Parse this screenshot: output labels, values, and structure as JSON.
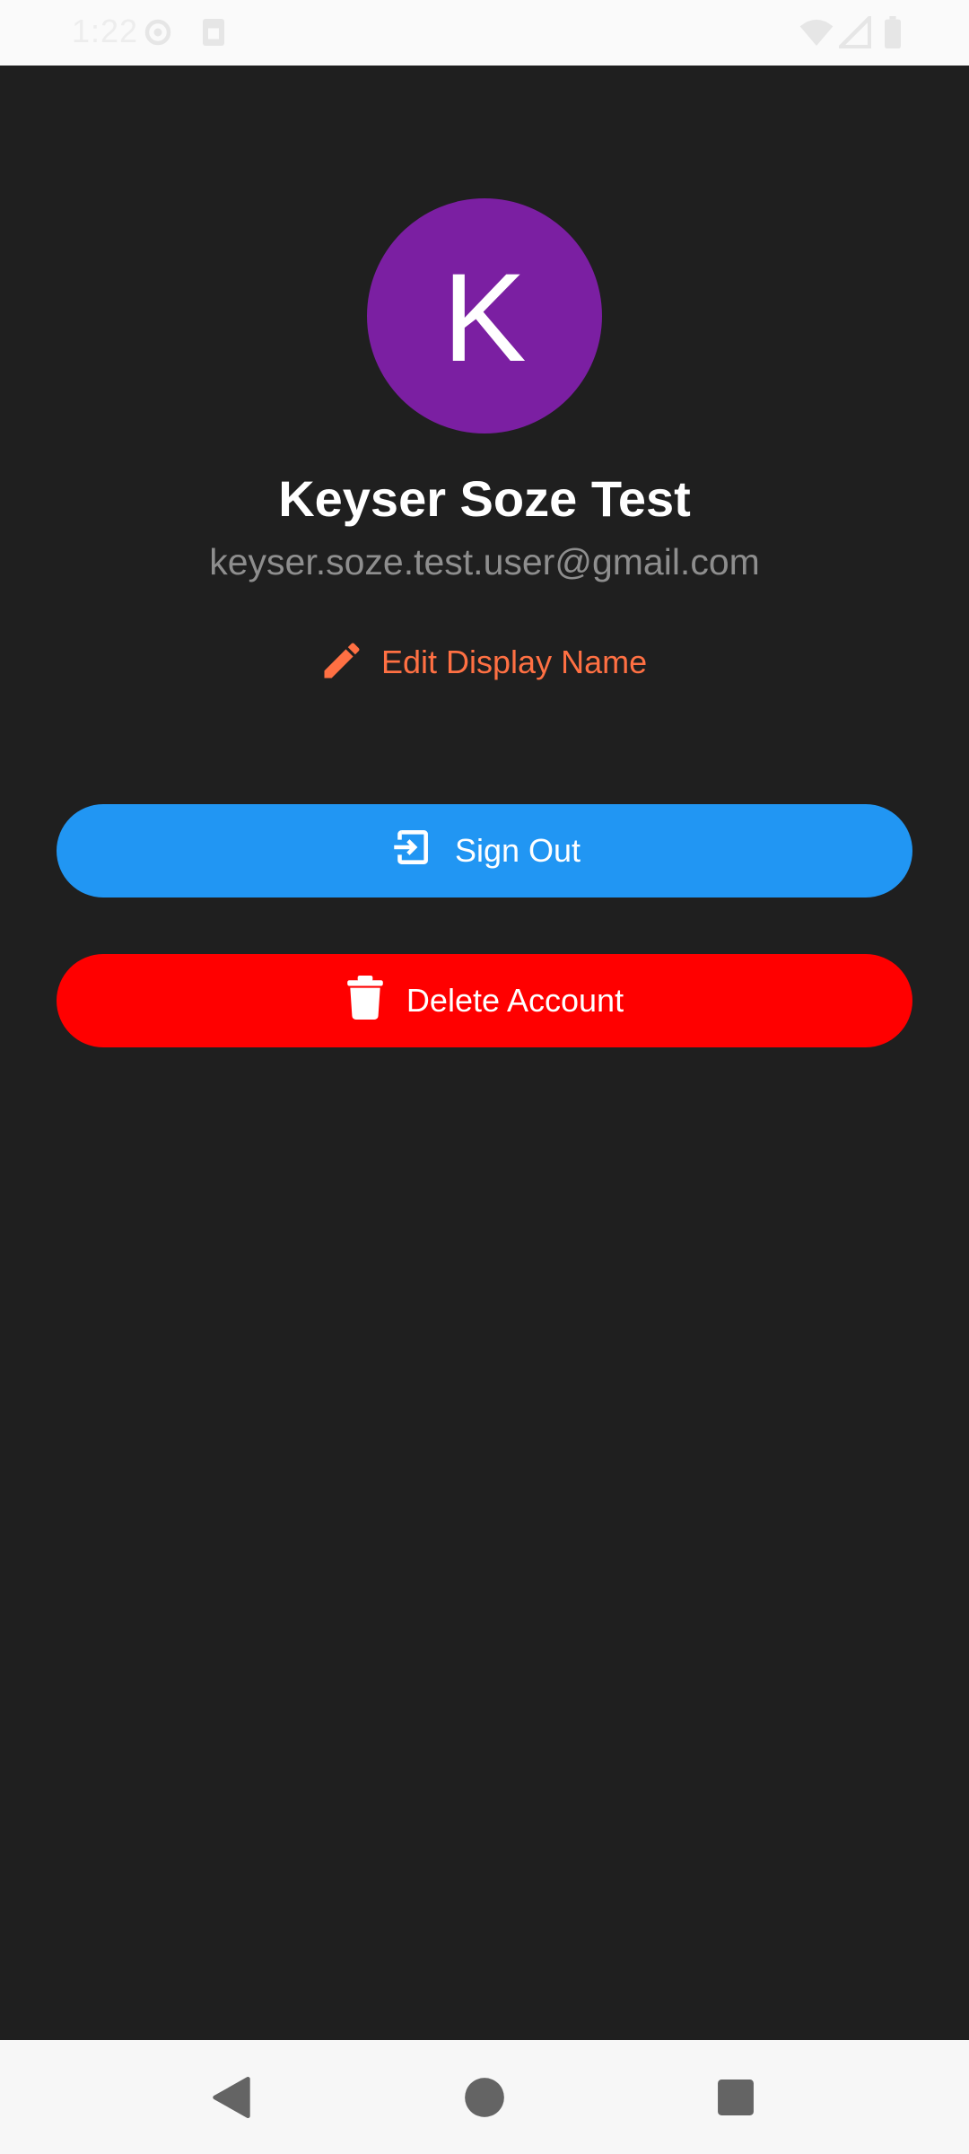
{
  "status_bar": {
    "time": "1:22",
    "icons": [
      "settings-icon",
      "sim-card-icon",
      "wifi-icon",
      "signal-icon",
      "battery-icon"
    ]
  },
  "profile": {
    "avatar_letter": "K",
    "avatar_color": "#7b1fa2",
    "name": "Keyser Soze Test",
    "email": "keyser.soze.test.user@gmail.com"
  },
  "actions": {
    "edit_label": "Edit Display Name",
    "edit_color": "#ff7043",
    "sign_out_label": "Sign Out",
    "sign_out_color": "#2196f3",
    "delete_label": "Delete Account",
    "delete_color": "#ff0000"
  },
  "nav_bar": {
    "buttons": [
      "back-icon",
      "home-icon",
      "recents-icon"
    ]
  }
}
